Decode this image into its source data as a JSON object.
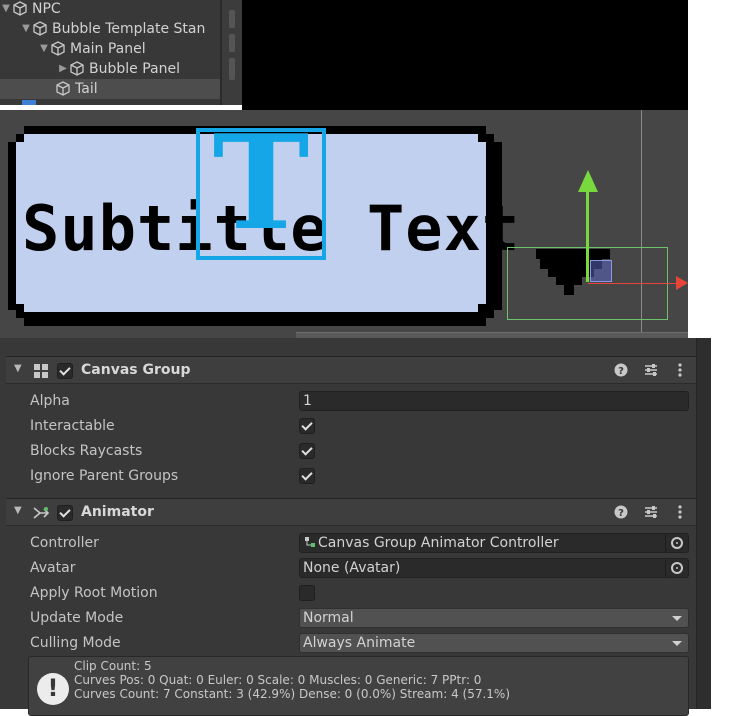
{
  "hierarchy": {
    "items": [
      {
        "label": "NPC",
        "expanded": true
      },
      {
        "label": "Bubble Template Stan",
        "expanded": true
      },
      {
        "label": "Main Panel",
        "expanded": true
      },
      {
        "label": "Bubble Panel",
        "expanded": false
      },
      {
        "label": "Tail",
        "selected": true
      }
    ]
  },
  "scene": {
    "subtitle_text": "Subtitle Text",
    "text_gizmo_glyph": "T"
  },
  "canvas_group": {
    "title": "Canvas Group",
    "enabled": true,
    "alpha_label": "Alpha",
    "alpha_value": "1",
    "interactable_label": "Interactable",
    "interactable": true,
    "blocks_raycasts_label": "Blocks Raycasts",
    "blocks_raycasts": true,
    "ignore_parent_groups_label": "Ignore Parent Groups",
    "ignore_parent_groups": true
  },
  "animator": {
    "title": "Animator",
    "enabled": true,
    "controller_label": "Controller",
    "controller_value": "Canvas Group Animator Controller",
    "avatar_label": "Avatar",
    "avatar_value": "None (Avatar)",
    "apply_root_motion_label": "Apply Root Motion",
    "apply_root_motion": false,
    "update_mode_label": "Update Mode",
    "update_mode_value": "Normal",
    "culling_mode_label": "Culling Mode",
    "culling_mode_value": "Always Animate",
    "info": {
      "line1": "Clip Count: 5",
      "line2": "Curves Pos: 0 Quat: 0 Euler: 0 Scale: 0 Muscles: 0 Generic: 7 PPtr: 0",
      "line3": "Curves Count: 7 Constant: 3 (42.9%) Dense: 0 (0.0%) Stream: 4 (57.1%)"
    }
  },
  "colors": {
    "accent_text_gizmo": "#14a6e6",
    "y_axis": "#7ad83f",
    "x_axis": "#e8453a",
    "bubble_fill": "#c2d0ef",
    "rect_gizmo": "#6ec26e"
  },
  "icons": {
    "hierarchy_item": "cube-icon",
    "canvas_group": "canvas-group-icon",
    "animator": "animator-icon",
    "help": "help-icon",
    "presets": "presets-icon",
    "menu": "kebab-menu-icon",
    "info": "info-icon"
  }
}
